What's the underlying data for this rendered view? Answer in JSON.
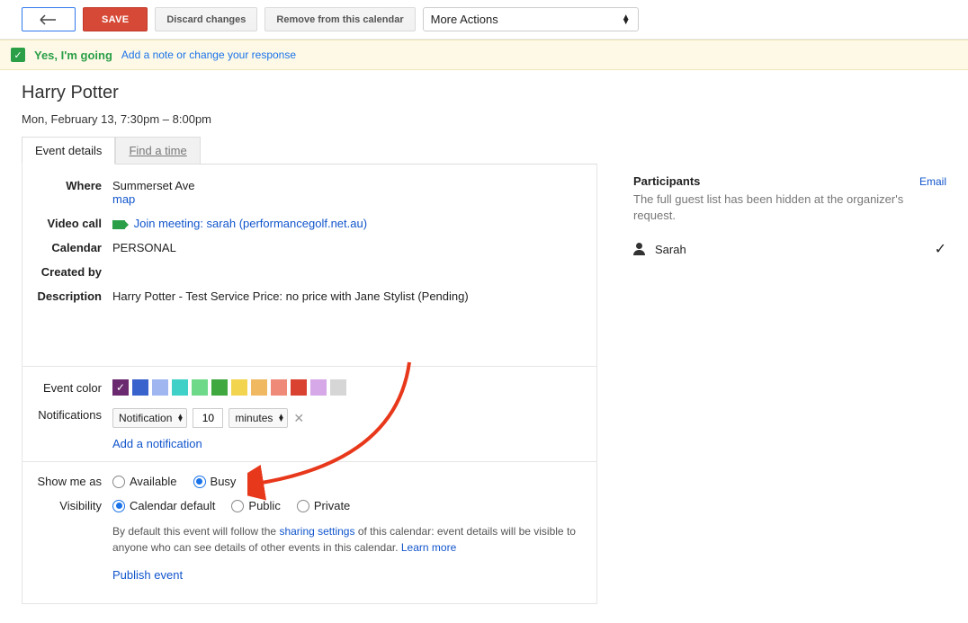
{
  "toolbar": {
    "save": "SAVE",
    "discard": "Discard changes",
    "remove": "Remove from this calendar",
    "more_actions": "More Actions"
  },
  "banner": {
    "going": "Yes, I'm going",
    "addnote": "Add a note or change your response"
  },
  "event": {
    "title": "Harry Potter",
    "datetime": "Mon, February 13, 7:30pm – 8:00pm"
  },
  "tabs": {
    "details": "Event details",
    "findtime": "Find a time"
  },
  "labels": {
    "where": "Where",
    "video": "Video call",
    "calendar": "Calendar",
    "createdby": "Created by",
    "description": "Description",
    "eventcolor": "Event color",
    "notifications": "Notifications",
    "showmeas": "Show me as",
    "visibility": "Visibility"
  },
  "values": {
    "where": "Summerset Ave",
    "map": "map",
    "video_link": "Join meeting: sarah (performancegolf.net.au)",
    "calendar": "PERSONAL",
    "description": "Harry Potter - Test Service Price: no price with Jane Stylist (Pending)"
  },
  "colors": [
    "#6b2a6f",
    "#3862cc",
    "#9fb6f0",
    "#3fd1c7",
    "#6fd98a",
    "#3fa83f",
    "#f2d44f",
    "#f0b860",
    "#f08a78",
    "#d94130",
    "#d6a8e8",
    "#d6d6d6"
  ],
  "selected_color_index": 0,
  "notification": {
    "type": "Notification",
    "value": "10",
    "unit": "minutes",
    "add": "Add a notification"
  },
  "showmeas": {
    "available": "Available",
    "busy": "Busy",
    "selected": "busy"
  },
  "visibility": {
    "default": "Calendar default",
    "public": "Public",
    "private": "Private",
    "selected": "default",
    "note_pre": "By default this event will follow the ",
    "sharing": "sharing settings",
    "note_post": " of this calendar: event details will be visible to anyone who can see details of other events in this calendar.  ",
    "learn": "Learn more",
    "publish": "Publish event"
  },
  "participants": {
    "heading": "Participants",
    "email": "Email",
    "note": "The full guest list has been hidden at the organizer's request.",
    "guest": "Sarah"
  }
}
